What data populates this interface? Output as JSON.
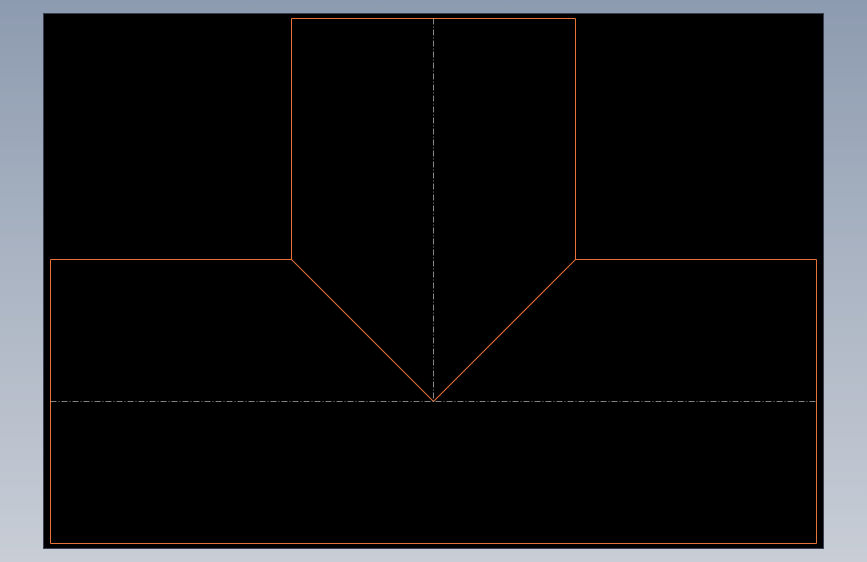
{
  "viewport": {
    "background_color": "#000000",
    "outline_color": "#e8733a",
    "centerline_color": "#c9c9c9",
    "outline_style": "solid",
    "centerline_style": "dash-dot"
  }
}
